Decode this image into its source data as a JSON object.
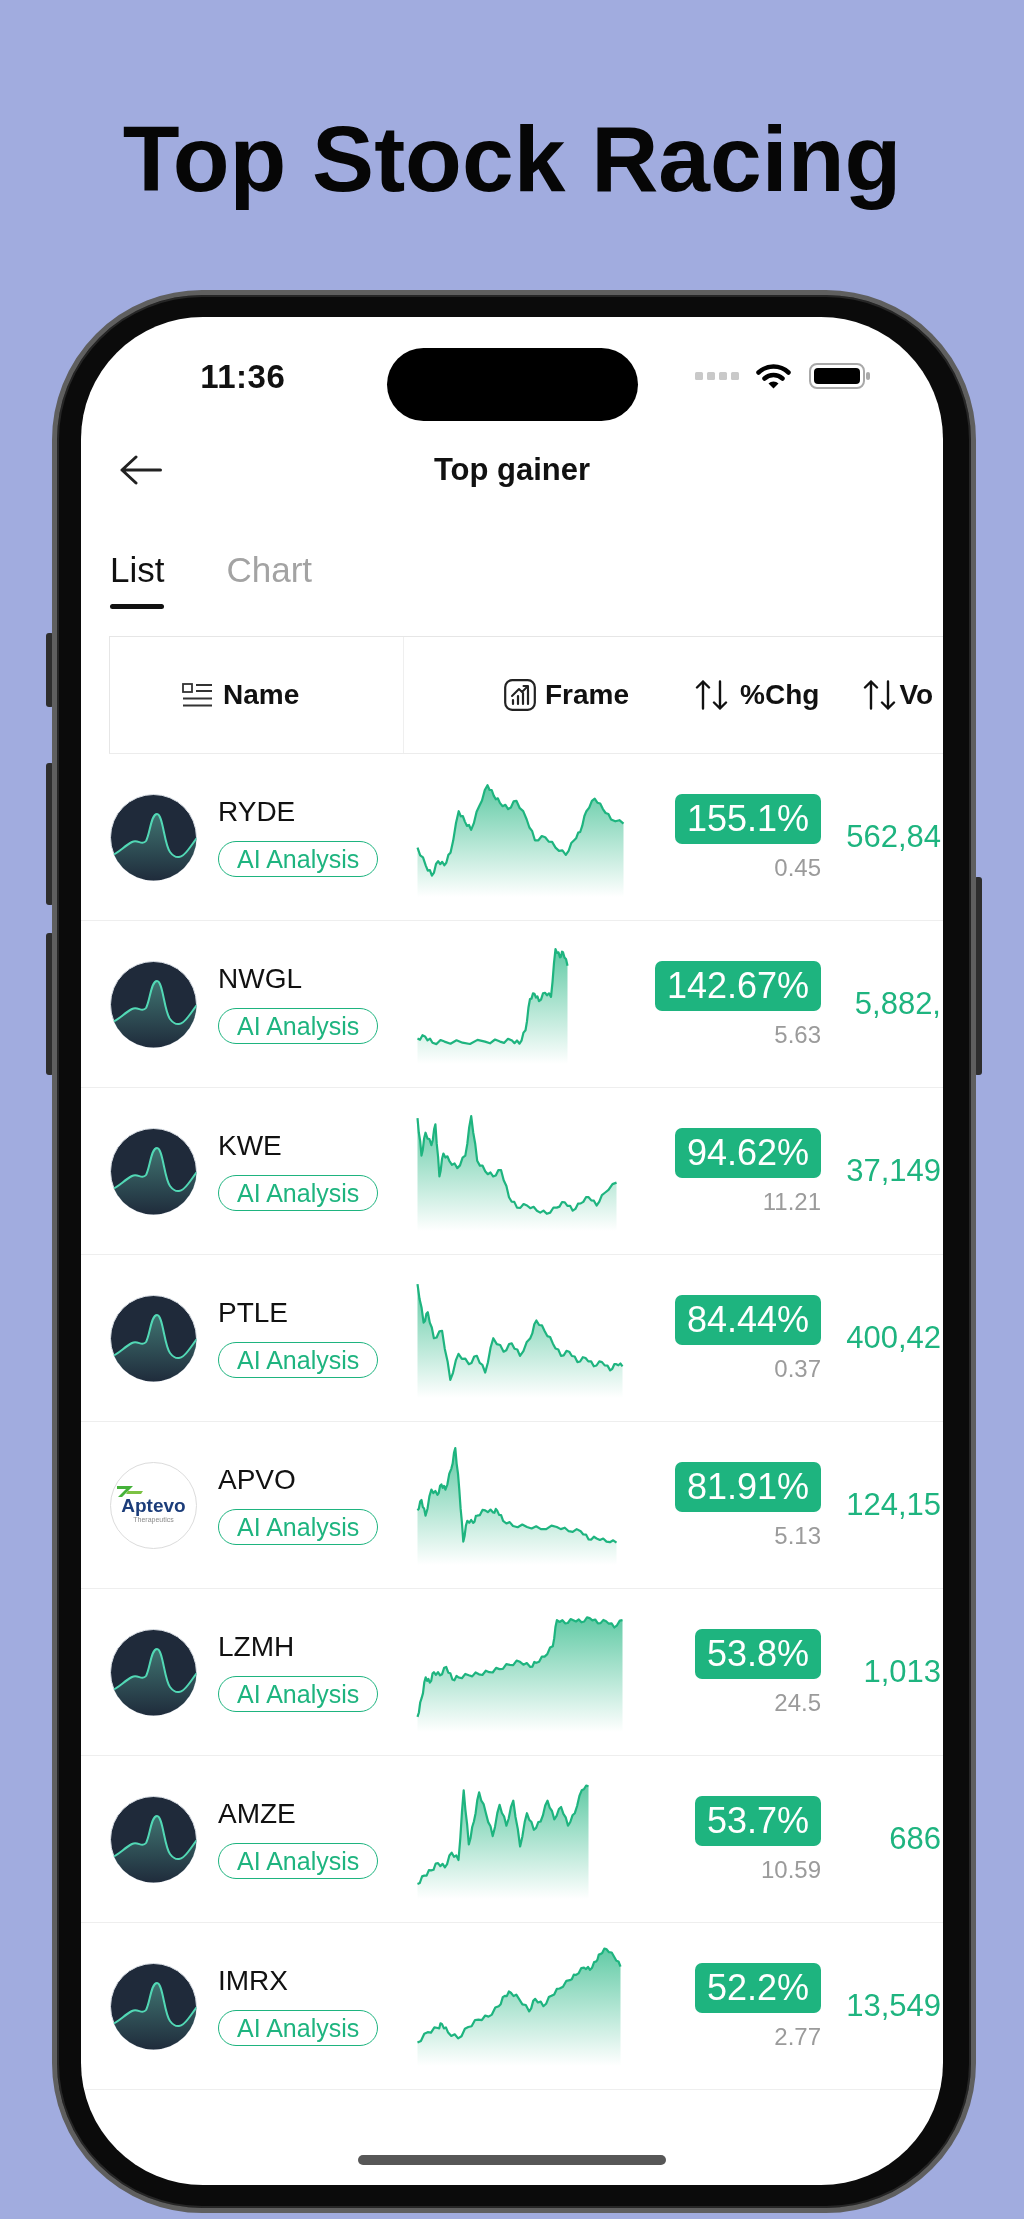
{
  "headline": "Top Stock Racing",
  "status_bar": {
    "time": "11:36"
  },
  "nav": {
    "title": "Top gainer"
  },
  "tabs": [
    {
      "label": "List",
      "selected": true
    },
    {
      "label": "Chart",
      "selected": false
    }
  ],
  "table": {
    "columns": [
      {
        "label": "Name",
        "kind": "list"
      },
      {
        "label": "Frame",
        "kind": "chart"
      },
      {
        "label": "%Chg",
        "kind": "sort"
      },
      {
        "label": "Vo",
        "kind": "sort"
      }
    ],
    "rows": [
      {
        "ticker": "RYDE",
        "logo": {
          "kind": "wave"
        },
        "action": "AI Analysis",
        "change": "155.1%",
        "price": "0.45",
        "column_4": "562,84"
      },
      {
        "ticker": "NWGL",
        "logo": {
          "kind": "wave"
        },
        "action": "AI Analysis",
        "change": "142.67%",
        "price": "5.63",
        "column_4": "5,882,"
      },
      {
        "ticker": "KWE",
        "logo": {
          "kind": "wave"
        },
        "action": "AI Analysis",
        "change": "94.62%",
        "price": "11.21",
        "column_4": "37,149"
      },
      {
        "ticker": "PTLE",
        "logo": {
          "kind": "wave"
        },
        "action": "AI Analysis",
        "change": "84.44%",
        "price": "0.37",
        "column_4": "400,42"
      },
      {
        "ticker": "APVO",
        "logo": {
          "kind": "logo",
          "text": "Aptevo",
          "subtext": "Therapeutics"
        },
        "action": "AI Analysis",
        "change": "81.91%",
        "price": "5.13",
        "column_4": "124,15"
      },
      {
        "ticker": "LZMH",
        "logo": {
          "kind": "wave"
        },
        "action": "AI Analysis",
        "change": "53.8%",
        "price": "24.5",
        "column_4": "1,013"
      },
      {
        "ticker": "AMZE",
        "logo": {
          "kind": "wave"
        },
        "action": "AI Analysis",
        "change": "53.7%",
        "price": "10.59",
        "column_4": "686"
      },
      {
        "ticker": "IMRX",
        "logo": {
          "kind": "wave"
        },
        "action": "AI Analysis",
        "change": "52.2%",
        "price": "2.77",
        "column_4": "13,549"
      }
    ]
  }
}
